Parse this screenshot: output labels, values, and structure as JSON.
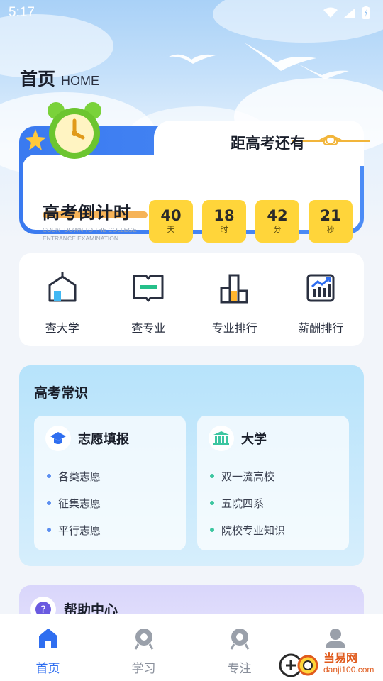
{
  "status_bar": {
    "time": "5:17"
  },
  "header": {
    "title": "首页",
    "subtitle": "HOME"
  },
  "countdown": {
    "tab_label": "距高考还有",
    "title": "高考倒计时",
    "subtitle": "COUNTDOWN TO THE COLLEGE ENTRANCE EXAMINATION",
    "units": [
      {
        "value": "40",
        "unit": "天"
      },
      {
        "value": "18",
        "unit": "时"
      },
      {
        "value": "42",
        "unit": "分"
      },
      {
        "value": "21",
        "unit": "秒"
      }
    ]
  },
  "tools": [
    {
      "label": "查大学",
      "icon": "university-icon"
    },
    {
      "label": "查专业",
      "icon": "book-icon"
    },
    {
      "label": "专业排行",
      "icon": "bar-chart-icon"
    },
    {
      "label": "薪酬排行",
      "icon": "salary-chart-icon"
    }
  ],
  "knowledge": {
    "title": "高考常识",
    "panels": [
      {
        "title": "志愿填报",
        "icon": "graduation-cap-icon",
        "dot_color": "#5b8ef0",
        "items": [
          "各类志愿",
          "征集志愿",
          "平行志愿"
        ]
      },
      {
        "title": "大学",
        "icon": "building-icon",
        "dot_color": "#3cc6a0",
        "items": [
          "双一流高校",
          "五院四系",
          "院校专业知识"
        ]
      }
    ]
  },
  "help": {
    "title": "帮助中心"
  },
  "bottom_nav": [
    {
      "label": "首页",
      "active": true
    },
    {
      "label": "学习",
      "active": false
    },
    {
      "label": "专注",
      "active": false
    },
    {
      "label": "",
      "active": false
    }
  ],
  "watermark": {
    "name": "当易网",
    "url": "danji100.com"
  },
  "colors": {
    "accent": "#2f6ef0",
    "countdown_box": "#ffd53a",
    "card_blue": "#3a7af0"
  }
}
